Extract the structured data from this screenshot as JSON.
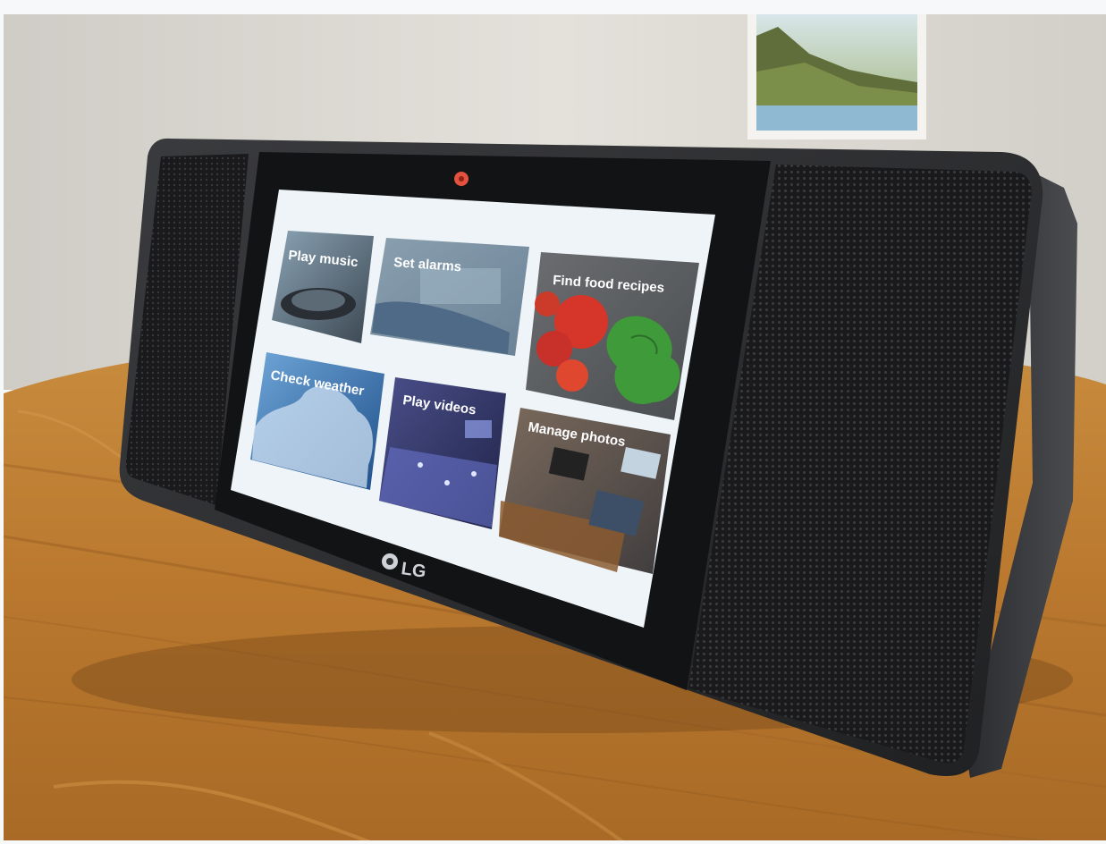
{
  "photo": {
    "description_free": true
  },
  "device": {
    "brand": "LG",
    "tiles": [
      {
        "label": "Play music",
        "theme": "turntable"
      },
      {
        "label": "Set alarms",
        "theme": "bedroom"
      },
      {
        "label": "Find food recipes",
        "theme": "tomatoes-basil"
      },
      {
        "label": "Check weather",
        "theme": "clouds"
      },
      {
        "label": "Play videos",
        "theme": "concert"
      },
      {
        "label": "Manage photos",
        "theme": "desk-photos"
      }
    ]
  },
  "colors": {
    "wood": "#c88a3a",
    "wall": "#d9d6cf",
    "device_body": "#2b2c2e",
    "speaker_grille": "#1c1c1e",
    "screen_bg": "#eef4f7",
    "camera_led": "#e4523d"
  }
}
